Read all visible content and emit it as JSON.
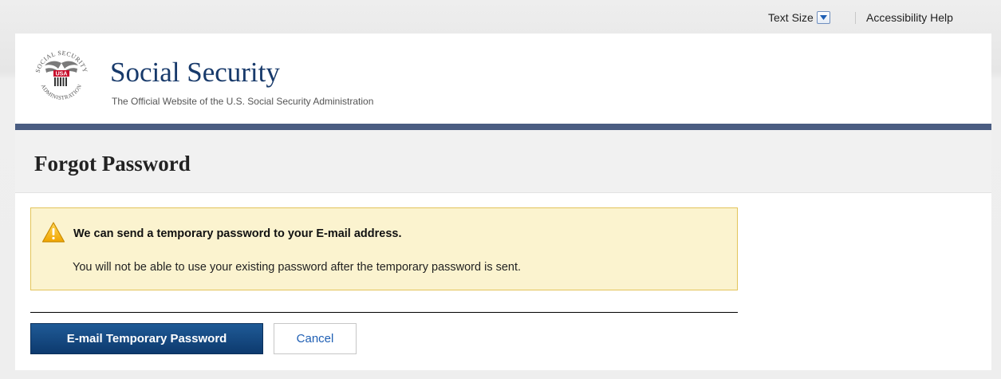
{
  "topbar": {
    "text_size_label": "Text Size",
    "accessibility_help": "Accessibility Help"
  },
  "header": {
    "seal_text_top": "SOCIAL SECURITY",
    "seal_text_bottom": "ADMINISTRATION",
    "seal_badge": "USA",
    "site_title": "Social Security",
    "site_subtitle": "The Official Website of the U.S. Social Security Administration"
  },
  "page": {
    "title": "Forgot Password"
  },
  "alert": {
    "icon": "warning-icon",
    "heading": "We can send a temporary password to your E-mail address.",
    "message": "You will not be able to use your existing password after the temporary password is sent."
  },
  "actions": {
    "primary_label": "E-mail Temporary Password",
    "cancel_label": "Cancel"
  },
  "colors": {
    "brand_navy": "#183a6b",
    "rule": "#4a5d82",
    "alert_bg": "#fbf3cf",
    "alert_border": "#e3c45a",
    "primary_button": "#0d3a6e",
    "link_blue": "#1f5fb4"
  }
}
